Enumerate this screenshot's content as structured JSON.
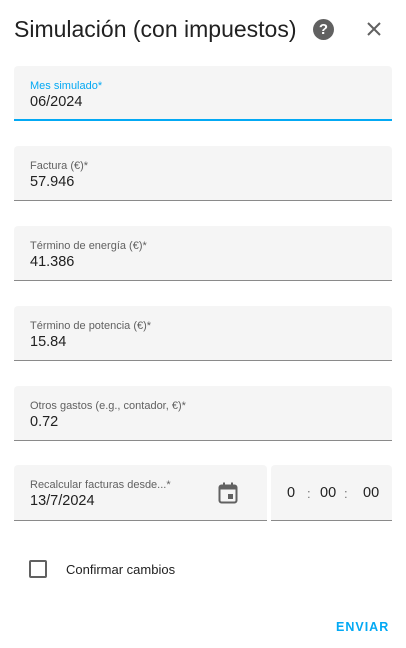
{
  "dialog": {
    "title": "Simulación (con impuestos)",
    "help_icon_text": "?",
    "close_icon": "close-icon"
  },
  "fields": {
    "month": {
      "label": "Mes simulado*",
      "value": "06/2024"
    },
    "invoice": {
      "label": "Factura (€)*",
      "value": "57.946"
    },
    "energy": {
      "label": "Término de energía (€)*",
      "value": "41.386"
    },
    "power": {
      "label": "Término de potencia (€)*",
      "value": "15.84"
    },
    "other": {
      "label": "Otros gastos (e.g., contador, €)*",
      "value": "0.72"
    },
    "recalc_date": {
      "label": "Recalcular facturas desde...*",
      "value": "13/7/2024"
    }
  },
  "time": {
    "hour": "0",
    "minute": "00",
    "second": "00",
    "separator": ":"
  },
  "confirm": {
    "label": "Confirmar cambios",
    "checked": false
  },
  "submit_label": "ENVIAR",
  "colors": {
    "accent": "#03a9f4",
    "field_bg": "#f5f5f5",
    "text": "#212121"
  }
}
